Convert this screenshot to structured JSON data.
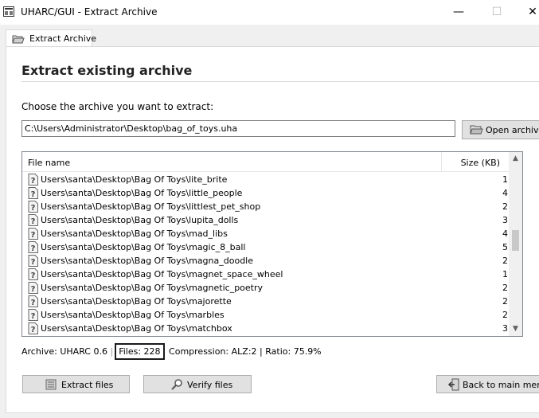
{
  "window": {
    "title": "UHARC/GUI - Extract Archive",
    "minimize_glyph": "—",
    "maximize_glyph": "☐",
    "close_glyph": "✕",
    "app_icon": "uharc-app-icon"
  },
  "tab": {
    "label": "Extract Archive",
    "icon": "folder-open-icon"
  },
  "heading": "Extract existing archive",
  "prompt": "Choose the archive you want to extract:",
  "archive_path": "C:\\Users\\Administrator\\Desktop\\bag_of_toys.uha",
  "open_button": {
    "label": "Open archive",
    "icon": "open-folder-icon"
  },
  "list": {
    "col_name": "File name",
    "col_size": "Size (KB)",
    "file_icon": "unknown-file-icon",
    "rows": [
      {
        "name": "Users\\santa\\Desktop\\Bag Of Toys\\lite_brite",
        "size": "1"
      },
      {
        "name": "Users\\santa\\Desktop\\Bag Of Toys\\little_people",
        "size": "4"
      },
      {
        "name": "Users\\santa\\Desktop\\Bag Of Toys\\littlest_pet_shop",
        "size": "2"
      },
      {
        "name": "Users\\santa\\Desktop\\Bag Of Toys\\lupita_dolls",
        "size": "3"
      },
      {
        "name": "Users\\santa\\Desktop\\Bag Of Toys\\mad_libs",
        "size": "4"
      },
      {
        "name": "Users\\santa\\Desktop\\Bag Of Toys\\magic_8_ball",
        "size": "5"
      },
      {
        "name": "Users\\santa\\Desktop\\Bag Of Toys\\magna_doodle",
        "size": "2"
      },
      {
        "name": "Users\\santa\\Desktop\\Bag Of Toys\\magnet_space_wheel",
        "size": "1"
      },
      {
        "name": "Users\\santa\\Desktop\\Bag Of Toys\\magnetic_poetry",
        "size": "2"
      },
      {
        "name": "Users\\santa\\Desktop\\Bag Of Toys\\majorette",
        "size": "2"
      },
      {
        "name": "Users\\santa\\Desktop\\Bag Of Toys\\marbles",
        "size": "2"
      },
      {
        "name": "Users\\santa\\Desktop\\Bag Of Toys\\matchbox",
        "size": "3"
      }
    ]
  },
  "status": {
    "archive": "Archive: UHARC 0.6",
    "files": "Files: 228",
    "compression": "Compression: ALZ:2",
    "ratio": "Ratio: 75.9%"
  },
  "buttons": {
    "extract": {
      "label": "Extract files",
      "icon": "extract-icon"
    },
    "verify": {
      "label": "Verify files",
      "icon": "magnifier-icon"
    },
    "back": {
      "label": "Back to main menu",
      "icon": "back-icon"
    }
  }
}
